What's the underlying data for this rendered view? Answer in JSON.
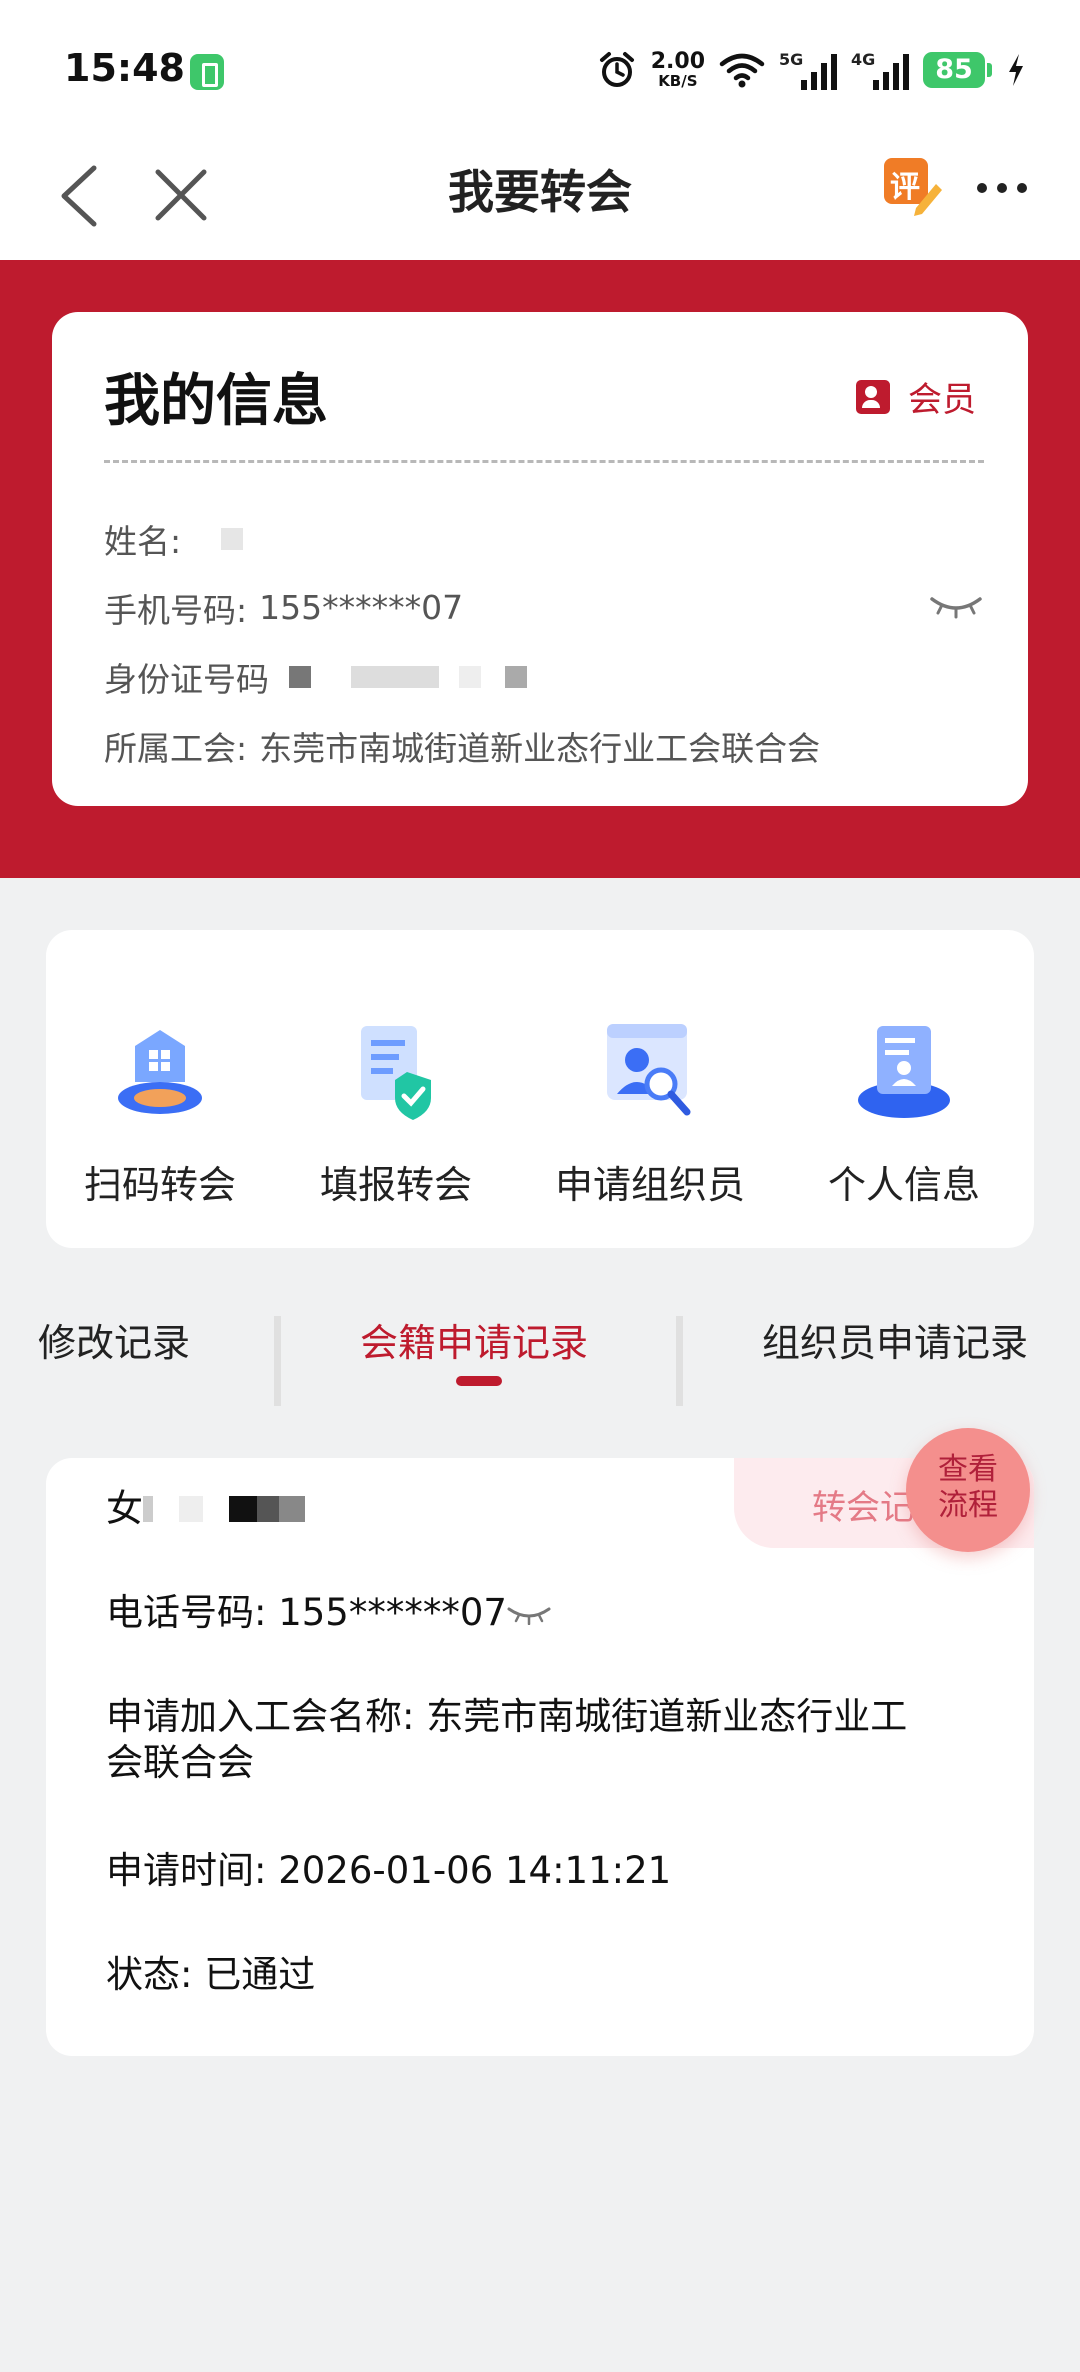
{
  "status_bar": {
    "time": "15:48",
    "speed_value": "2.00",
    "speed_unit": "KB/S",
    "net1": "5G",
    "net2": "4G",
    "battery": "85"
  },
  "nav": {
    "title": "我要转会",
    "evaluate_label": "评"
  },
  "info_card": {
    "title": "我的信息",
    "member_label": "会员",
    "name_label": "姓名:",
    "phone_label": "手机号码:",
    "phone_value": "155******07",
    "id_label": "身份证号码",
    "union_label": "所属工会:",
    "union_value": "东莞市南城街道新业态行业工会联合会"
  },
  "actions": [
    {
      "label": "扫码转会",
      "icon": "scan-transfer-icon"
    },
    {
      "label": "填报转会",
      "icon": "fill-form-icon"
    },
    {
      "label": "申请组织员",
      "icon": "apply-organizer-icon"
    },
    {
      "label": "个人信息",
      "icon": "personal-info-icon"
    }
  ],
  "tabs": [
    {
      "label": "修改记录",
      "active": false
    },
    {
      "label": "会籍申请记录",
      "active": true
    },
    {
      "label": "组织员申请记录",
      "active": false
    }
  ],
  "record": {
    "type_badge": "转会记",
    "phone": "电话号码: 155******07",
    "union": "申请加入工会名称: 东莞市南城街道新业态行业工会联合会",
    "union_line1": "申请加入工会名称: 东莞市南城街道新业态行业工",
    "union_line2": "会联合会",
    "time": "申请时间: 2026-01-06 14:11:21",
    "status": "状态: 已通过",
    "name_char": "女"
  },
  "fab": {
    "line1": "查看",
    "line2": "流程"
  },
  "colors": {
    "brand_red": "#be1b2e",
    "battery_green": "#3ec76a",
    "fab_pink": "#f48f8d"
  }
}
